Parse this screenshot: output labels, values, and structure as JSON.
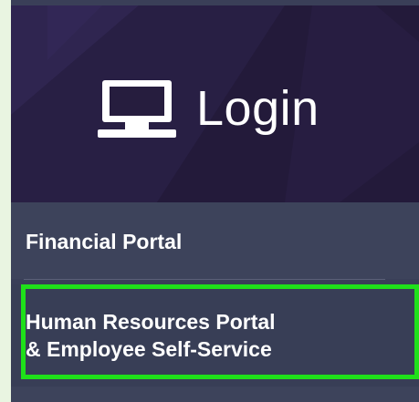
{
  "login_header": {
    "icon": "monitor-icon",
    "title": "Login"
  },
  "portals": {
    "financial": {
      "label": "Financial Portal"
    },
    "hr": {
      "line1": "Human Resources Portal",
      "line2": "& Employee Self-Service"
    }
  },
  "colors": {
    "header_bg": "#261d3e",
    "menu_bg": "#3a3f58",
    "highlight": "#1fe01a",
    "page_bg": "#e9f5e1"
  }
}
